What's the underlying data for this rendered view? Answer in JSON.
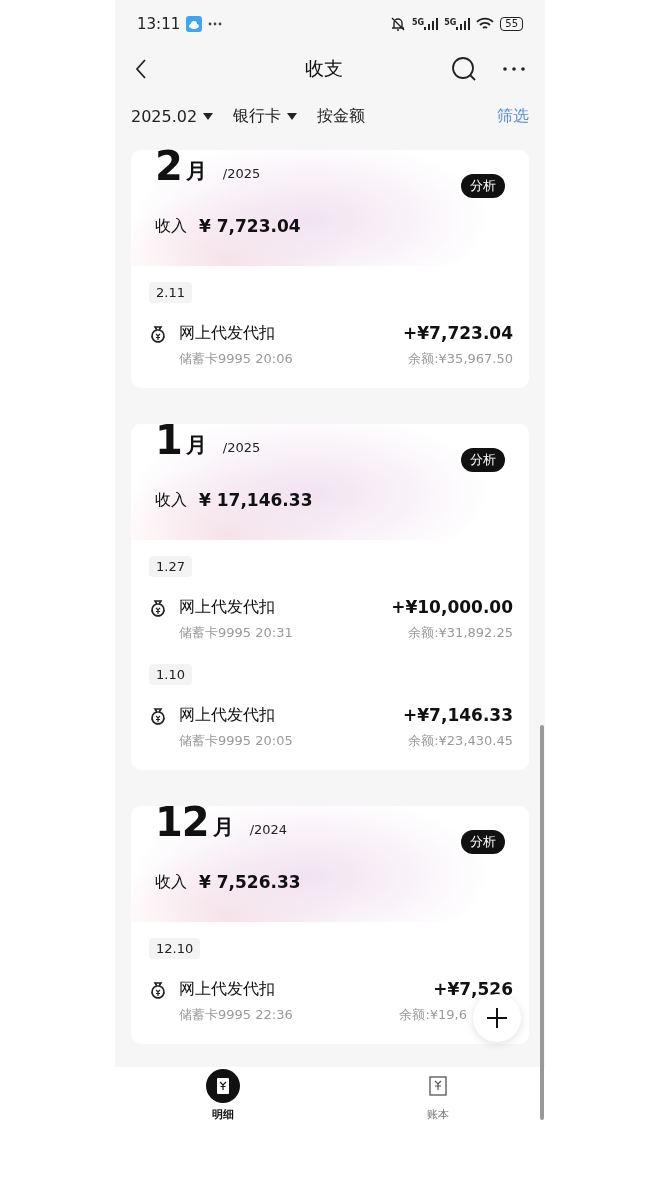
{
  "status_bar": {
    "time": "13:11",
    "network_1": "5G",
    "network_2": "5G",
    "battery": "55"
  },
  "header": {
    "title": "收支"
  },
  "filters": [
    {
      "label": "2025.02",
      "kind": "dropdown"
    },
    {
      "label": "银行卡",
      "kind": "dropdown"
    },
    {
      "label": "按金额",
      "kind": "plain"
    }
  ],
  "filter_button": "筛选",
  "months": [
    {
      "month": "2",
      "unit": "月",
      "year": "/2025",
      "analyze": "分析",
      "income_label": "收入",
      "income": "¥ 7,723.04",
      "groups": [
        {
          "date": "2.11",
          "items": [
            {
              "title": "网上代发代扣",
              "detail": "储蓄卡9995 20:06",
              "amount": "+¥7,723.04",
              "balance": "余额:¥35,967.50"
            }
          ]
        }
      ]
    },
    {
      "month": "1",
      "unit": "月",
      "year": "/2025",
      "analyze": "分析",
      "income_label": "收入",
      "income": "¥ 17,146.33",
      "groups": [
        {
          "date": "1.27",
          "items": [
            {
              "title": "网上代发代扣",
              "detail": "储蓄卡9995 20:31",
              "amount": "+¥10,000.00",
              "balance": "余额:¥31,892.25"
            }
          ]
        },
        {
          "date": "1.10",
          "items": [
            {
              "title": "网上代发代扣",
              "detail": "储蓄卡9995 20:05",
              "amount": "+¥7,146.33",
              "balance": "余额:¥23,430.45"
            }
          ]
        }
      ]
    },
    {
      "month": "12",
      "unit": "月",
      "year": "/2024",
      "analyze": "分析",
      "income_label": "收入",
      "income": "¥ 7,526.33",
      "groups": [
        {
          "date": "12.10",
          "items": [
            {
              "title": "网上代发代扣",
              "detail": "储蓄卡9995 22:36",
              "amount": "+¥7,526",
              "balance": "余额:¥19,6"
            }
          ]
        }
      ]
    }
  ],
  "bottom_nav": [
    {
      "label": "明细",
      "selected": true
    },
    {
      "label": "账本",
      "selected": false
    }
  ]
}
